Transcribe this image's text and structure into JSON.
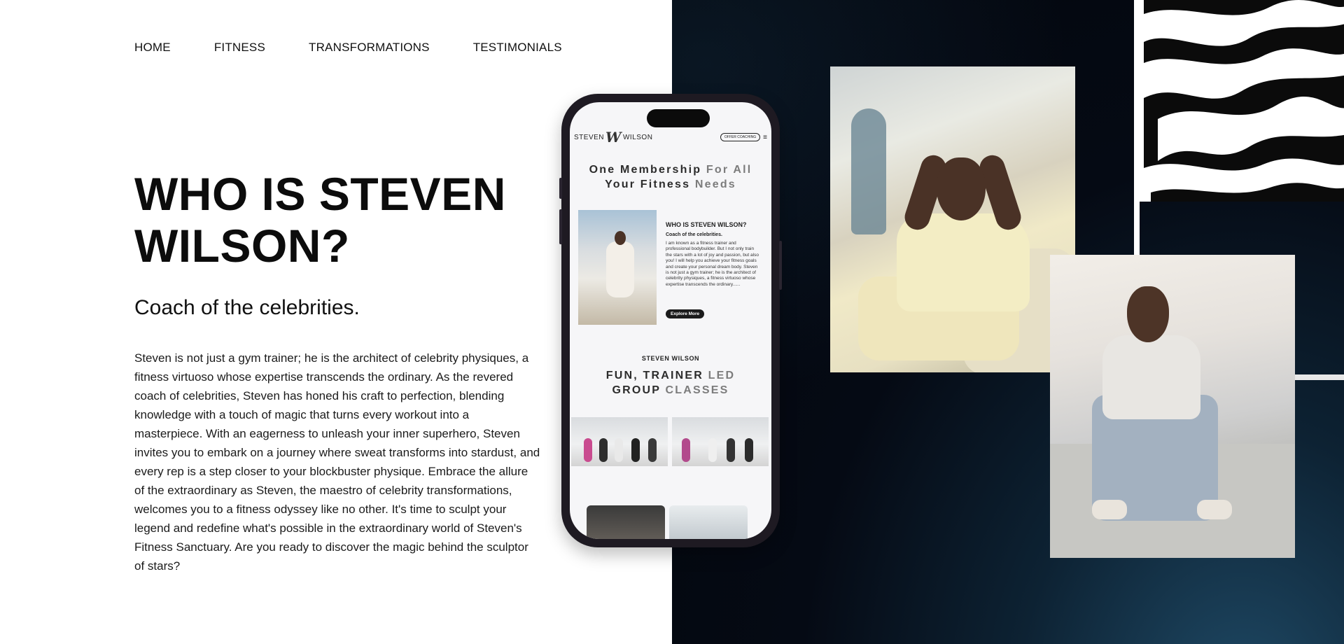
{
  "nav": {
    "items": [
      {
        "label": "HOME"
      },
      {
        "label": "FITNESS"
      },
      {
        "label": "TRANSFORMATIONS"
      },
      {
        "label": "TESTIMONIALS"
      }
    ]
  },
  "hero": {
    "title": "WHO IS STEVEN WILSON?",
    "subtitle": "Coach of the celebrities.",
    "body": "Steven is not just a gym trainer; he is the architect of celebrity physiques, a fitness virtuoso whose expertise transcends the ordinary. As the revered coach of celebrities, Steven has honed his craft to perfection, blending knowledge with a touch of magic that turns every workout into a masterpiece. With an eagerness to unleash your inner superhero, Steven invites you to embark on a journey where sweat transforms into stardust, and every rep is a step closer to your blockbuster physique. Embrace the allure of the extraordinary as Steven, the maestro of celebrity transformations, welcomes you to a fitness odyssey like no other. It's time to sculpt your legend and redefine what's possible in the extraordinary world of Steven's Fitness Sanctuary. Are you ready to discover the magic behind the sculptor of stars?"
  },
  "phone": {
    "logo_left": "STEVEN",
    "logo_mark": "W",
    "logo_right": "WILSON",
    "header_button": "OFFER COACHING",
    "menu_icon": "≡",
    "heading1_dark": "One Membership",
    "heading1_fade": "For All",
    "heading1_line2_dark": "Your Fitness",
    "heading1_line2_fade": "Needs",
    "who_title": "WHO IS STEVEN WILSON?",
    "coach_line": "Coach of the celebrities.",
    "who_text": "I am known as a fitness trainer and professional bodybuilder. But I not only train the stars with a lot of joy and passion, but also you! I will help you achieve your fitness goals and create your personal dream body. Steven is not just a gym trainer; he is the architect of celebrity physiques, a fitness virtuoso whose expertise transcends the ordinary......",
    "explore_button": "Explore More",
    "brand_name": "STEVEN WILSON",
    "heading2_dark": "FUN, TRAINER",
    "heading2_fade": "LED",
    "heading2_line2_dark": "GROUP",
    "heading2_line2_fade": "CLASSES"
  },
  "colors": {
    "right_bg": "#03060c",
    "accent_blue": "#1f4a66",
    "text": "#111111"
  },
  "icons": {
    "menu": "hamburger-icon"
  }
}
